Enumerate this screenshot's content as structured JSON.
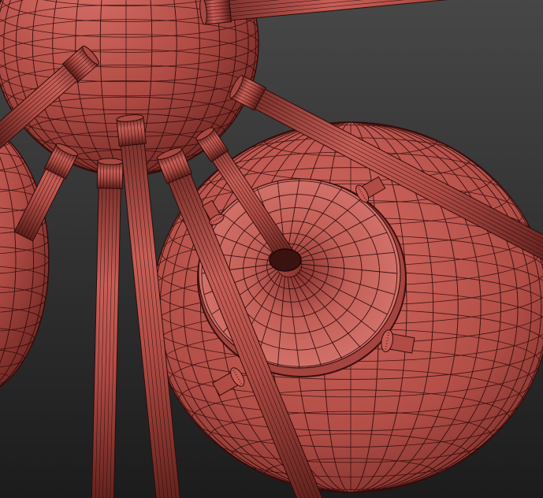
{
  "viewport": {
    "background_top": "#474747",
    "background_bottom": "#1c1c1c"
  },
  "material": {
    "base": "#b04c45",
    "highlight": "#d46a62",
    "shadow": "#5b1f1c",
    "wire": "#2a0808"
  },
  "scene_objects": [
    {
      "name": "sphere-top",
      "icon": "sphere-mesh-icon"
    },
    {
      "name": "sphere-left",
      "icon": "sphere-mesh-icon"
    },
    {
      "name": "sphere-center",
      "icon": "sphere-mesh-icon"
    },
    {
      "name": "rods",
      "icon": "cylinder-mesh-icon"
    },
    {
      "name": "screws",
      "icon": "screw-mesh-icon"
    }
  ]
}
